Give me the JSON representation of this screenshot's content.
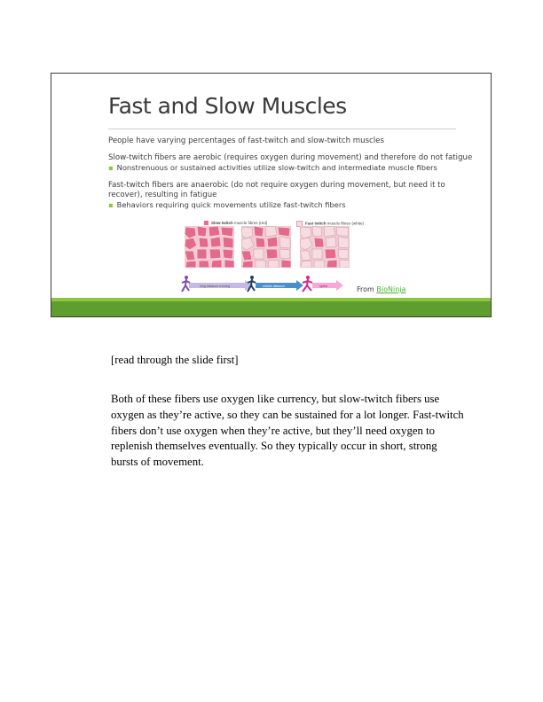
{
  "slide": {
    "title": "Fast and Slow Muscles",
    "intro": "People have varying percentages of fast-twitch and slow-twitch muscles",
    "slow_line": "Slow-twitch fibers are aerobic (requires oxygen during movement) and therefore do not fatigue",
    "slow_bullet": "Nonstrenuous or sustained activities utilize slow-twitch and intermediate muscle fibers",
    "fast_line1": "Fast-twitch fibers are anaerobic (do not require oxygen during movement, but need it to",
    "fast_line2": "recover), resulting in fatigue",
    "fast_bullet": "Behaviors requiring quick movements utilize fast-twitch fibers",
    "bullet_glyph": "▪",
    "figure": {
      "legend_slow_bold": "Slow twitch",
      "legend_slow_rest": "muscle fibres (red)",
      "legend_fast_bold": "Fast twitch",
      "legend_fast_rest": "muscle fibres (white)",
      "arrow1": "long distance running",
      "arrow2": "middle distance",
      "arrow3": "sprint"
    },
    "credit_prefix": "From",
    "credit_link": "BioNinja",
    "colors": {
      "accent_dark": "#5e9e2e",
      "accent_light": "#8cc63f",
      "link": "#4caf30",
      "slow_fiber": "#e86e8f",
      "fast_fiber": "#f6d9df"
    }
  },
  "notes": {
    "p1": "[read through the slide first]",
    "p2": "Both of these fibers use oxygen like currency, but slow-twitch fibers use oxygen as they’re active, so they can be sustained for a lot longer. Fast-twitch fibers don’t use oxygen when they’re active, but they’ll need oxygen to replenish themselves eventually. So they typically occur in short, strong bursts of movement."
  }
}
